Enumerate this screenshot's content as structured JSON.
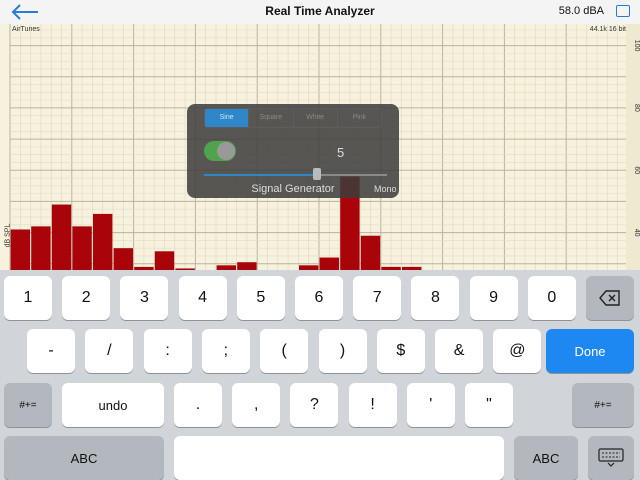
{
  "topbar": {
    "title": "Real Time Analyzer",
    "level": "58.0 dBA",
    "back_icon": "arrow-left-icon",
    "share_icon": "share-icon"
  },
  "plot": {
    "source_label": "AirTunes",
    "rate_label": "44.1k 16 bit",
    "ylabel": "dB SPL",
    "yticks": [
      "100",
      "80",
      "60",
      "40"
    ],
    "bar_color": "#a8040a",
    "background": "#f7f2dd"
  },
  "chart_data": {
    "type": "bar",
    "ylabel": "dB SPL",
    "ylim": [
      28,
      105
    ],
    "yticks": [
      100,
      80,
      60,
      40
    ],
    "grid": true,
    "values": [
      41,
      42,
      49,
      42,
      46,
      35,
      29,
      34,
      28.5,
      28,
      29.5,
      30.5,
      28,
      28,
      29.5,
      32,
      58,
      39,
      29,
      29,
      28
    ]
  },
  "generator": {
    "tabs": [
      {
        "label": "Sine",
        "active": true
      },
      {
        "label": "Square",
        "active": false
      },
      {
        "label": "White",
        "active": false
      },
      {
        "label": "Pink",
        "active": false
      }
    ],
    "enabled": true,
    "value": "5",
    "slider_fraction": 0.62,
    "name": "Signal Generator",
    "channel": "Mono"
  },
  "keyboard": {
    "row1": [
      "1",
      "2",
      "3",
      "4",
      "5",
      "6",
      "7",
      "8",
      "9",
      "0"
    ],
    "delete_icon": "backspace-icon",
    "row2": [
      "-",
      "/",
      ":",
      ";",
      "(",
      ")",
      "$",
      "&",
      "@"
    ],
    "done": "Done",
    "row3_left": "#+=",
    "undo": "undo",
    "row3": [
      ".",
      ",",
      "?",
      "!",
      "'",
      "\""
    ],
    "row3_right": "#+=",
    "abc_left": "ABC",
    "abc_right": "ABC",
    "dismiss_icon": "keyboard-dismiss-icon",
    "accent": "#1e88f2"
  }
}
